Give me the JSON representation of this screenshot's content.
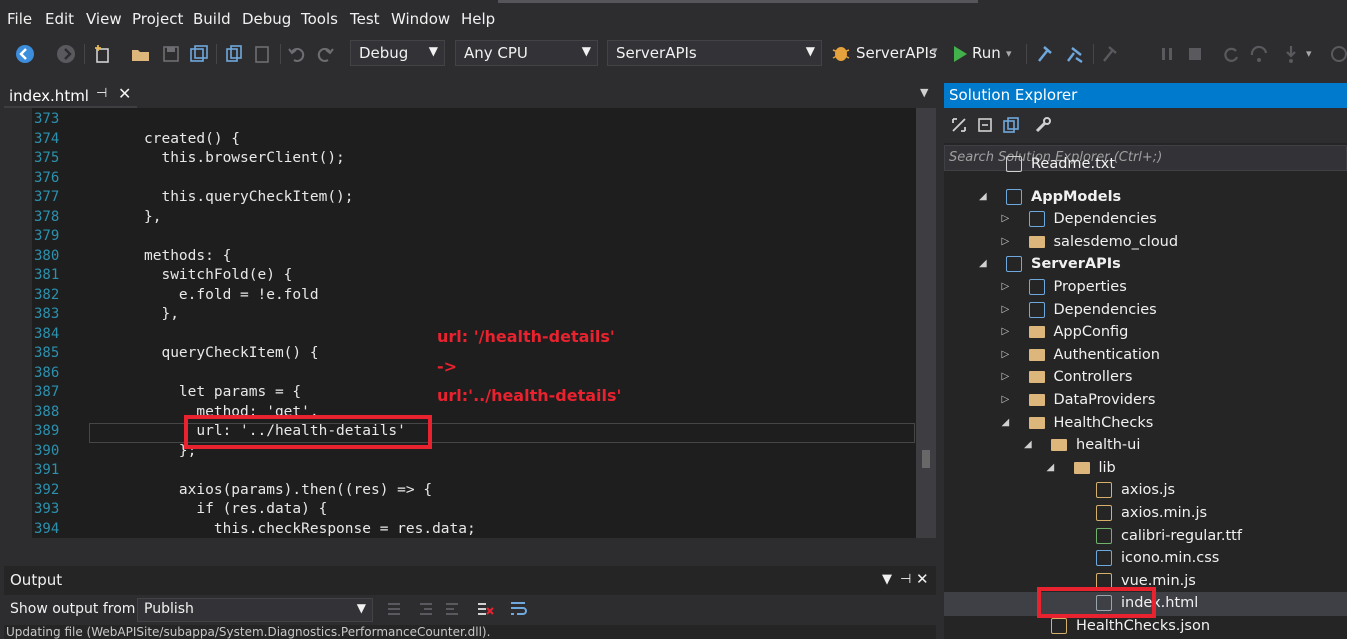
{
  "menu": [
    "File",
    "Edit",
    "View",
    "Project",
    "Build",
    "Debug",
    "Tools",
    "Test",
    "Window",
    "Help"
  ],
  "toolbar": {
    "config": "Debug",
    "platform": "Any CPU",
    "startup_project": "ServerAPIs",
    "run_target": "ServerAPIs",
    "run_label": "Run"
  },
  "editor": {
    "tab_title": "index.html",
    "lines": [
      {
        "n": "373",
        "code": ""
      },
      {
        "n": "374",
        "code": "created() {"
      },
      {
        "n": "375",
        "code": "  this.browserClient();"
      },
      {
        "n": "376",
        "code": ""
      },
      {
        "n": "377",
        "code": "  this.queryCheckItem();"
      },
      {
        "n": "378",
        "code": "},"
      },
      {
        "n": "379",
        "code": ""
      },
      {
        "n": "380",
        "code": "methods: {"
      },
      {
        "n": "381",
        "code": "  switchFold(e) {"
      },
      {
        "n": "382",
        "code": "    e.fold = !e.fold"
      },
      {
        "n": "383",
        "code": "  },"
      },
      {
        "n": "384",
        "code": ""
      },
      {
        "n": "385",
        "code": "  queryCheckItem() {"
      },
      {
        "n": "386",
        "code": ""
      },
      {
        "n": "387",
        "code": "    let params = {"
      },
      {
        "n": "388",
        "code": "      method: 'get',"
      },
      {
        "n": "389",
        "code": "      url: '../health-details'"
      },
      {
        "n": "390",
        "code": "    };"
      },
      {
        "n": "391",
        "code": ""
      },
      {
        "n": "392",
        "code": "    axios(params).then((res) => {"
      },
      {
        "n": "393",
        "code": "      if (res.data) {"
      },
      {
        "n": "394",
        "code": "        this.checkResponse = res.data;"
      }
    ]
  },
  "annotation": {
    "old": "url: '/health-details'",
    "arrow": "->",
    "new": "url:'../health-details'"
  },
  "output": {
    "title": "Output",
    "show_from_label": "Show output from:",
    "source": "Publish",
    "log_line": "Updating file (WebAPISite/subappa/System.Diagnostics.PerformanceCounter.dll)."
  },
  "solution_explorer": {
    "title": "Solution Explorer",
    "search_placeholder": "Search Solution Explorer (Ctrl+;)",
    "items": [
      {
        "label": "Readme.txt",
        "icon": "text-file-icon"
      },
      {
        "label": "AppModels",
        "icon": "csharp-project-icon"
      },
      {
        "label": "Dependencies",
        "icon": "dependencies-icon"
      },
      {
        "label": "salesdemo_cloud",
        "icon": "folder-icon"
      },
      {
        "label": "ServerAPIs",
        "icon": "web-project-icon"
      },
      {
        "label": "Properties",
        "icon": "wrench-icon"
      },
      {
        "label": "Dependencies",
        "icon": "dependencies-icon"
      },
      {
        "label": "AppConfig",
        "icon": "folder-icon"
      },
      {
        "label": "Authentication",
        "icon": "folder-icon"
      },
      {
        "label": "Controllers",
        "icon": "folder-icon"
      },
      {
        "label": "DataProviders",
        "icon": "folder-icon"
      },
      {
        "label": "HealthChecks",
        "icon": "folder-open-icon"
      },
      {
        "label": "health-ui",
        "icon": "folder-open-icon"
      },
      {
        "label": "lib",
        "icon": "folder-open-icon"
      },
      {
        "label": "axios.js",
        "icon": "js-file-icon"
      },
      {
        "label": "axios.min.js",
        "icon": "js-file-icon"
      },
      {
        "label": "calibri-regular.ttf",
        "icon": "font-file-icon"
      },
      {
        "label": "icono.min.css",
        "icon": "css-file-icon"
      },
      {
        "label": "vue.min.js",
        "icon": "js-file-icon"
      },
      {
        "label": "index.html",
        "icon": "html-file-icon"
      },
      {
        "label": "HealthChecks.json",
        "icon": "json-file-icon"
      }
    ]
  },
  "colors": {
    "accent": "#007acc",
    "annotation": "#e8222e",
    "line_number": "#2b91af"
  }
}
